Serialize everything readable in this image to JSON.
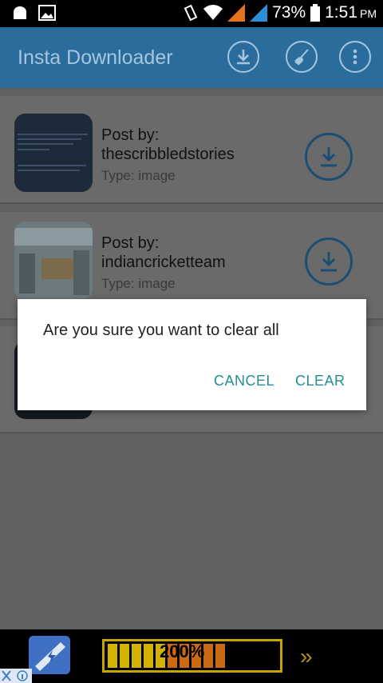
{
  "status_bar": {
    "battery": "73%",
    "time": "1:51",
    "ampm": "PM"
  },
  "app_bar": {
    "title": "Insta Downloader"
  },
  "posts": [
    {
      "post_by_label": "Post by:",
      "username": "thescribbledstories",
      "type": "Type: image"
    },
    {
      "post_by_label": "Post by:",
      "username": "indiancricketteam",
      "type": "Type: image"
    }
  ],
  "dialog": {
    "message": "Are you sure you want to clear all",
    "cancel_label": "CANCEL",
    "clear_label": "CLEAR"
  },
  "ad": {
    "percent": "200%",
    "arrows": "»"
  },
  "colors": {
    "app_bar": "#2a6d9c",
    "accent": "#268f96"
  }
}
